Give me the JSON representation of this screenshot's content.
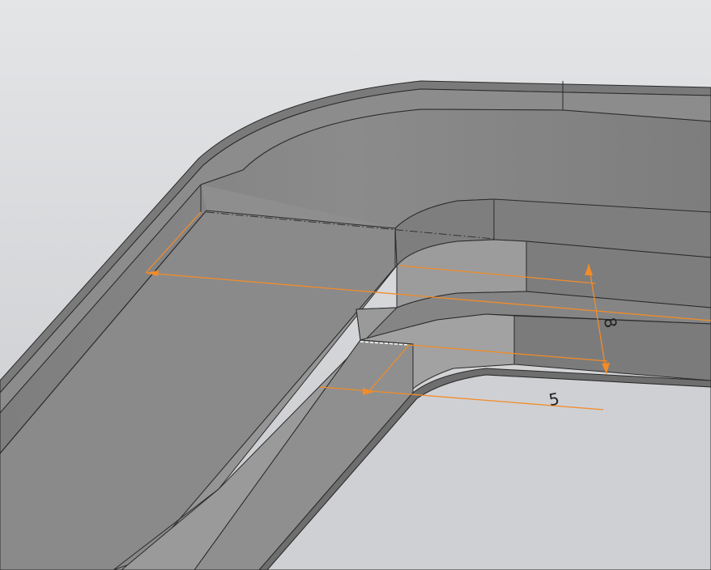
{
  "viewport": {
    "background_top": "#e3e4e6",
    "background_bottom": "#c9cbcf",
    "part_face_color": "#8a8a8a",
    "part_edge_color": "#2a2a2a",
    "dimension_color": "#f28c28"
  },
  "dimensions": {
    "height_label": "8",
    "width_label": "5"
  }
}
